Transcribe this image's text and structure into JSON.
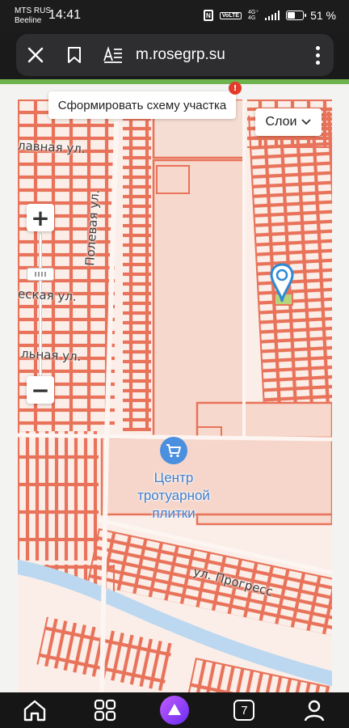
{
  "status_bar": {
    "carrier_line1": "MTS RUS",
    "carrier_line2": "Beeline",
    "time": "14:41",
    "nfc_label": "N",
    "volte_label": "VoLTE",
    "network_top": "4G⁺",
    "network_bottom": "4G",
    "battery_percent": "51 %",
    "battery_level": 0.51
  },
  "browser": {
    "url": "m.rosegrp.su",
    "close_icon": "close-icon",
    "bookmark_icon": "bookmark-icon",
    "reader_icon": "reader-mode-icon",
    "menu_icon": "more-vertical-icon"
  },
  "map": {
    "scheme_button_label": "Сформировать схему участка",
    "badge_text": "!",
    "layers_button_label": "Слои",
    "zoom_in_label": "+",
    "zoom_out_label": "−",
    "streets": {
      "glavnaya": "лавная ул.",
      "polevaya": "Полевая ул.",
      "eskaya": "еская ул.",
      "lnaya": "льная ул.",
      "progress": "ул. Прогресс"
    },
    "poi": {
      "icon": "shopping-cart-icon",
      "label_line1": "Центр",
      "label_line2": "тротуарной",
      "label_line3": "плитки"
    },
    "marker_icon": "location-pin-icon"
  },
  "bottom_nav": {
    "home_icon": "home-icon",
    "services_icon": "grid-icon",
    "assistant_icon": "alice-assistant-icon",
    "tabs_count": "7",
    "profile_icon": "profile-icon"
  },
  "colors": {
    "parcel_line": "#e8735a",
    "map_bg": "#fbeee8",
    "poi_blue": "#3e7fd0",
    "marker_blue": "#2b8ad6",
    "river": "#bcd8f0",
    "assistant_purple": "#8b3cf7"
  }
}
